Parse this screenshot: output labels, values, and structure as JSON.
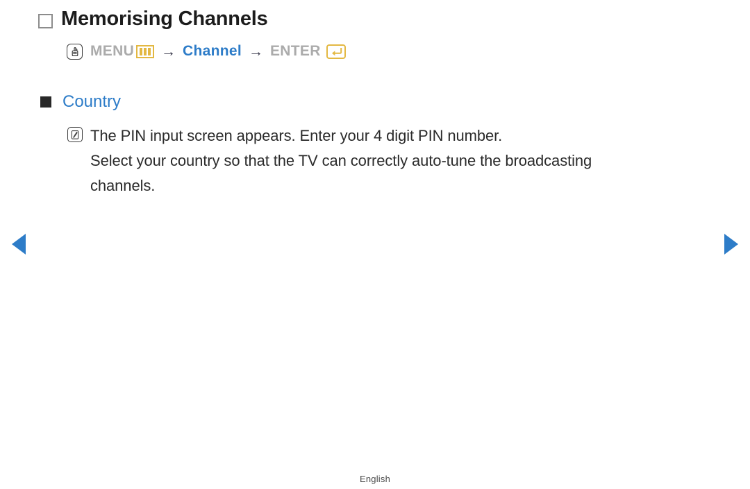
{
  "page": {
    "title": "Memorising Channels",
    "title_bullet_icon": "hollow-square-bullet-icon",
    "footer_language": "English"
  },
  "menu_path": {
    "remote_icon": "remote-hand-press-icon",
    "steps": [
      {
        "label": "MENU",
        "color": "#ababab",
        "icon": "menu-bars-icon"
      },
      {
        "label": "Channel",
        "color": "#2d7cc8",
        "icon": null
      },
      {
        "label": "ENTER",
        "color": "#ababab",
        "icon": "enter-return-icon"
      }
    ],
    "separator": "→"
  },
  "section": {
    "bullet_icon": "filled-square-bullet-icon",
    "title": "Country",
    "note_icon": "note-pencil-icon",
    "note_lines": [
      "The PIN input screen appears. Enter your 4 digit PIN number.",
      "Select your country so that the TV can correctly auto-tune the broadcasting",
      "channels."
    ]
  },
  "navigation": {
    "prev_label": "Previous page",
    "next_label": "Next page"
  },
  "colors": {
    "accent_blue": "#2d7cc8",
    "gold": "#e3b842",
    "gray_label": "#ababab",
    "body_text": "#2b2b2b"
  }
}
